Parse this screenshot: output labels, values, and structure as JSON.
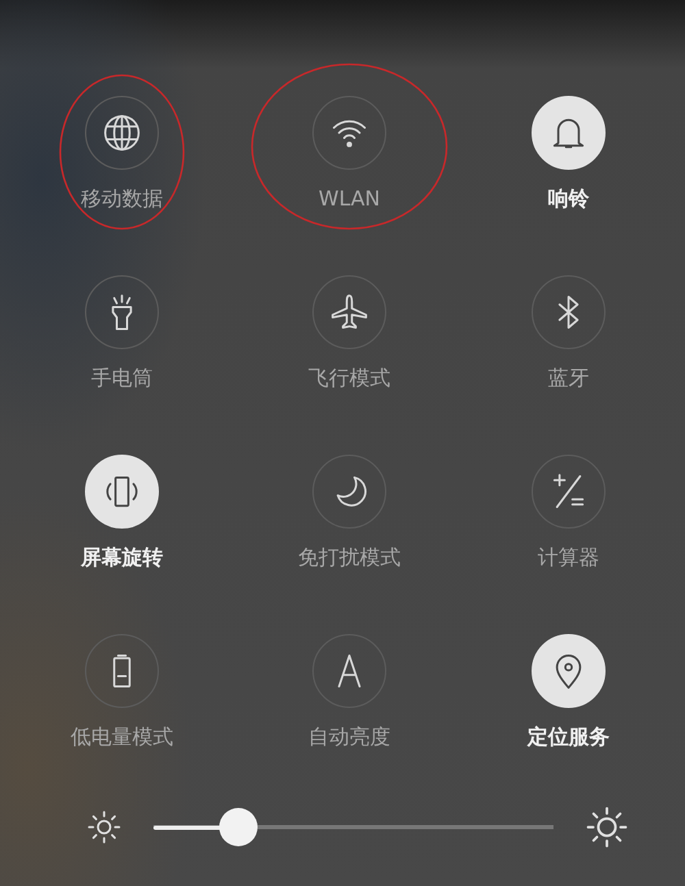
{
  "tiles": [
    {
      "label": "移动数据",
      "on": false,
      "circled": true
    },
    {
      "label": "WLAN",
      "on": false,
      "circled": true
    },
    {
      "label": "响铃",
      "on": true,
      "circled": false
    },
    {
      "label": "手电筒",
      "on": false,
      "circled": false
    },
    {
      "label": "飞行模式",
      "on": false,
      "circled": false
    },
    {
      "label": "蓝牙",
      "on": false,
      "circled": false
    },
    {
      "label": "屏幕旋转",
      "on": true,
      "circled": false
    },
    {
      "label": "免打扰模式",
      "on": false,
      "circled": false
    },
    {
      "label": "计算器",
      "on": false,
      "circled": false
    },
    {
      "label": "低电量模式",
      "on": false,
      "circled": false
    },
    {
      "label": "自动亮度",
      "on": false,
      "circled": false
    },
    {
      "label": "定位服务",
      "on": true,
      "circled": false
    }
  ],
  "brightness": {
    "level": 0.18
  }
}
